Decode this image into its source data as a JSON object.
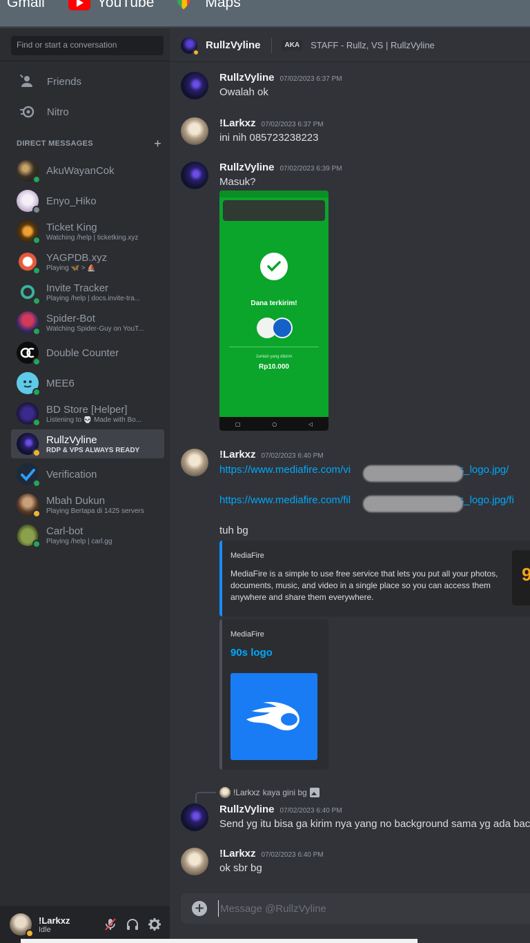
{
  "bookmarks": [
    {
      "label": "Gmail",
      "icon": "gmail-icon"
    },
    {
      "label": "YouTube",
      "icon": "youtube-icon"
    },
    {
      "label": "Maps",
      "icon": "maps-icon"
    }
  ],
  "sidebar": {
    "search_placeholder": "Find or start a conversation",
    "friends_label": "Friends",
    "nitro_label": "Nitro",
    "dm_header": "DIRECT MESSAGES",
    "dms": [
      {
        "name": "AkuWayanCok",
        "sub": "",
        "status": "online"
      },
      {
        "name": "Enyo_Hiko",
        "sub": "",
        "status": "offline"
      },
      {
        "name": "Ticket King",
        "sub": "Watching /help | ticketking.xyz",
        "status": "online"
      },
      {
        "name": "YAGPDB.xyz",
        "sub": "Playing 🦋 > ⛵",
        "status": "online"
      },
      {
        "name": "Invite Tracker",
        "sub": "Playing /help | docs.invite-tra...",
        "status": "online"
      },
      {
        "name": "Spider-Bot",
        "sub": "Watching Spider-Guy on YouT...",
        "status": "online"
      },
      {
        "name": "Double Counter",
        "sub": "",
        "status": "online"
      },
      {
        "name": "MEE6",
        "sub": "",
        "status": "online"
      },
      {
        "name": "BD Store [Helper]",
        "sub": "Listening to 💀 Made with Bo...",
        "status": "online"
      },
      {
        "name": "RullzVyline",
        "sub": "RDP & VPS ALWAYS READY",
        "status": "idle"
      },
      {
        "name": "Verification",
        "sub": "",
        "status": "online"
      },
      {
        "name": "Mbah Dukun",
        "sub": "Playing Bertapa di 1425 servers",
        "status": "idle"
      },
      {
        "name": "Carl-bot",
        "sub": "Playing /help | carl.gg",
        "status": "online"
      }
    ]
  },
  "user_panel": {
    "name": "!Larkxz",
    "status": "Idle"
  },
  "header": {
    "name": "RullzVyline",
    "aka": "AKA",
    "nicknames": "STAFF - Rullz, VS | RullzVyline"
  },
  "messages": {
    "m1": {
      "author": "RullzVyline",
      "time": "07/02/2023 6:37 PM",
      "text": "Owalah ok"
    },
    "m2": {
      "author": "!Larkxz",
      "time": "07/02/2023 6:37 PM",
      "text": "ini nih 085723238223"
    },
    "m3": {
      "author": "RullzVyline",
      "time": "07/02/2023 6:39 PM",
      "text": "Masuk?"
    },
    "m4": {
      "author": "!Larkxz",
      "time": "07/02/2023 6:40 PM",
      "link1_start": "https://www.mediafire.com/vi",
      "link1_end": "90s_logo.jpg/",
      "link2_start": "https://www.mediafire.com/fil",
      "link2_end": "90s_logo.jpg/fi",
      "text": "tuh bg"
    },
    "m5": {
      "reply_author": "!Larkxz",
      "reply_text": "kaya gini bg",
      "author": "RullzVyline",
      "time": "07/02/2023 6:40 PM",
      "text": "Send yg itu bisa ga kirim nya yang no background sama yg ada back"
    },
    "m6": {
      "author": "!Larkxz",
      "time": "07/02/2023 6:40 PM",
      "text": "ok sbr bg"
    }
  },
  "dana": {
    "title": "Dana terkirim!",
    "jumlah_label": "Jumlah yang dikirim",
    "amount": "Rp10.000"
  },
  "embed": {
    "provider": "MediaFire",
    "description": "MediaFire is a simple to use free service that lets you put all your photos, documents, music, and video in a single place so you can access them anywhere and share them everywhere."
  },
  "embed2": {
    "provider": "MediaFire",
    "title": "90s logo"
  },
  "composer": {
    "placeholder": "Message @RullzVyline"
  },
  "colors": {
    "background": "#313338",
    "sidebar": "#2b2d31",
    "link": "#00a8fc",
    "online": "#23a55a",
    "idle": "#f0b232",
    "mediafire_blue": "#1a7cf5"
  }
}
